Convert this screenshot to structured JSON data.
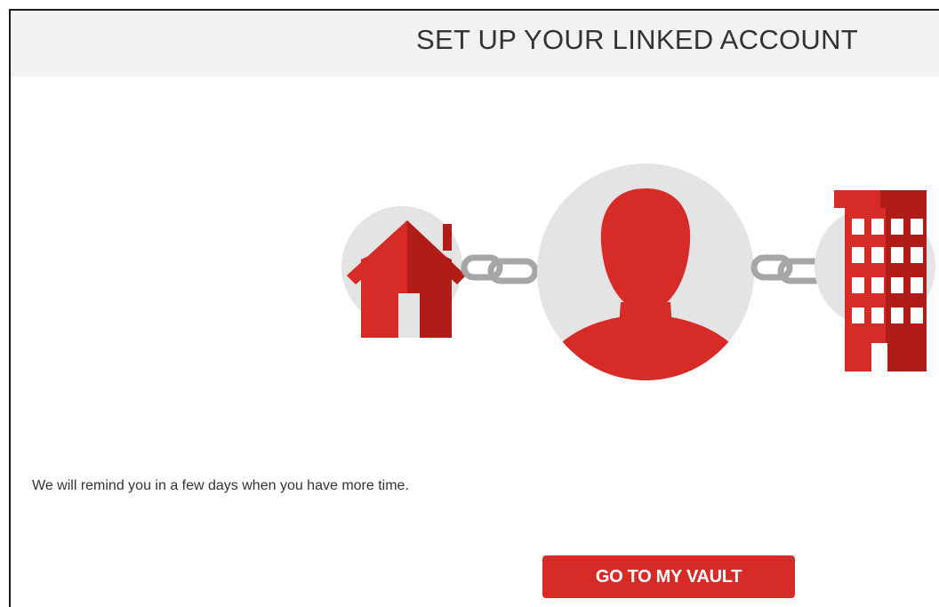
{
  "header": {
    "title": "SET UP YOUR LINKED ACCOUNT"
  },
  "illustration": {
    "icons": [
      "house-icon",
      "chain-link-icon",
      "person-avatar-icon",
      "chain-link-icon",
      "office-building-icon"
    ],
    "colors": {
      "accent_red": "#d62b27",
      "dark_red": "#b01c18",
      "circle_gray": "#e4e4e4",
      "chain_gray": "#a6a6a6"
    }
  },
  "main": {
    "message": "We will remind you in a few days when you have more time."
  },
  "actions": {
    "vault_button_label": "GO TO MY VAULT"
  }
}
